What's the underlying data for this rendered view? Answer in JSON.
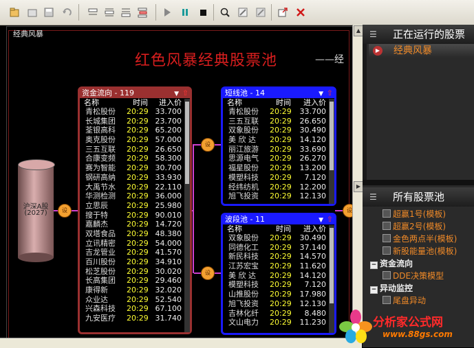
{
  "toolbar": {
    "buttons": [
      "new-icon",
      "open-icon",
      "save-icon",
      "undo-icon",
      "layout1-icon",
      "layout2-icon",
      "layout3-icon",
      "layout4-icon",
      "run-icon",
      "pause-icon",
      "stop-icon",
      "search-icon",
      "edit-icon",
      "clear-icon",
      "export-icon",
      "close-icon"
    ]
  },
  "canvas": {
    "tab_title": "经典风暴",
    "main_title": "红色风暴经典股票池",
    "title_tail": "——经"
  },
  "source": {
    "label": "沪深A股",
    "count": "(2027)"
  },
  "connector_label": "设",
  "pools": [
    {
      "id": "capital",
      "title": "资金流向 - 119",
      "color": "#9a3030",
      "cols": {
        "name": "名称",
        "time": "时间",
        "price": "进入价"
      },
      "rows": [
        [
          "青松股份",
          "20:29",
          "33.700"
        ],
        [
          "长城集团",
          "20:29",
          "23.700"
        ],
        [
          "荃银高科",
          "20:29",
          "65.200"
        ],
        [
          "奥克股份",
          "20:29",
          "57.000"
        ],
        [
          "三五互联",
          "20:29",
          "26.650"
        ],
        [
          "合康变频",
          "20:29",
          "58.300"
        ],
        [
          "赛为智能",
          "20:29",
          "30.700"
        ],
        [
          "钢研高纳",
          "20:29",
          "33.930"
        ],
        [
          "大禹节水",
          "20:29",
          "22.110"
        ],
        [
          "华测检测",
          "20:29",
          "36.000"
        ],
        [
          "立思辰",
          "20:29",
          "25.980"
        ],
        [
          "搜于特",
          "20:29",
          "90.010"
        ],
        [
          "嘉麟杰",
          "20:29",
          "14.720"
        ],
        [
          "双塔食品",
          "20:29",
          "48.380"
        ],
        [
          "立讯精密",
          "20:29",
          "54.000"
        ],
        [
          "吉龙管业",
          "20:29",
          "41.570"
        ],
        [
          "百川股份",
          "20:29",
          "34.910"
        ],
        [
          "松芝股份",
          "20:29",
          "30.020"
        ],
        [
          "长高集团",
          "20:29",
          "29.460"
        ],
        [
          "康得新",
          "20:29",
          "32.020"
        ],
        [
          "众业达",
          "20:29",
          "52.540"
        ],
        [
          "兴森科技",
          "20:29",
          "67.100"
        ],
        [
          "九安医疗",
          "20:29",
          "31.740"
        ]
      ]
    },
    {
      "id": "short",
      "title": "短线池 - 14",
      "color": "#1a1aff",
      "cols": {
        "name": "名称",
        "time": "时间",
        "price": "进入价"
      },
      "rows": [
        [
          "青松股份",
          "20:29",
          "33.700"
        ],
        [
          "三五互联",
          "20:29",
          "26.650"
        ],
        [
          "双象股份",
          "20:29",
          "30.490"
        ],
        [
          "美 欣 达",
          "20:29",
          "14.120"
        ],
        [
          "丽江旅游",
          "20:29",
          "33.690"
        ],
        [
          "思源电气",
          "20:29",
          "26.270"
        ],
        [
          "福星股份",
          "20:29",
          "13.200"
        ],
        [
          "模塑科技",
          "20:29",
          "7.120"
        ],
        [
          "经纬纺机",
          "20:29",
          "12.200"
        ],
        [
          "旭飞投资",
          "20:29",
          "12.130"
        ]
      ]
    },
    {
      "id": "wave",
      "title": "波段池 - 11",
      "color": "#1a1aff",
      "cols": {
        "name": "名称",
        "time": "时间",
        "price": "进入价"
      },
      "rows": [
        [
          "双象股份",
          "20:29",
          "30.490"
        ],
        [
          "同德化工",
          "20:29",
          "37.140"
        ],
        [
          "新民科技",
          "20:29",
          "14.570"
        ],
        [
          "江苏宏宝",
          "20:29",
          "11.620"
        ],
        [
          "美 欣 达",
          "20:29",
          "14.120"
        ],
        [
          "模塑科技",
          "20:29",
          "7.120"
        ],
        [
          "山推股份",
          "20:29",
          "17.980"
        ],
        [
          "旭飞投资",
          "20:29",
          "12.130"
        ],
        [
          "吉林化纤",
          "20:29",
          "8.480"
        ],
        [
          "文山电力",
          "20:29",
          "11.230"
        ]
      ]
    }
  ],
  "right_panel": {
    "running_header": "正在运行的股票",
    "running_items": [
      "经典风暴"
    ],
    "all_header": "所有股票池",
    "tree": [
      {
        "type": "item",
        "label": "超赢1号(模板)"
      },
      {
        "type": "item",
        "label": "超赢2号(模板)"
      },
      {
        "type": "item",
        "label": "金色两点半(模板)"
      },
      {
        "type": "item",
        "label": "新股能量池(模板)"
      },
      {
        "type": "group",
        "label": "资金流向"
      },
      {
        "type": "item",
        "label": "DDE决策模型"
      },
      {
        "type": "group",
        "label": "异动监控"
      },
      {
        "type": "item",
        "label": "尾盘异动"
      }
    ]
  },
  "logo": {
    "name": "分析家公式网",
    "url": "www.88gs.com"
  }
}
